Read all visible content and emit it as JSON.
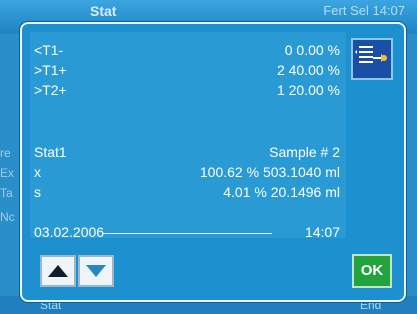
{
  "background": {
    "title": "Stat",
    "info": "Fert Sel 14:07",
    "left_fragments": [
      "re",
      "Ex",
      "Ta",
      "Nc"
    ],
    "bottom_left": "Stat",
    "bottom_right": "End"
  },
  "dialog": {
    "rows": [
      {
        "label": "<T1-",
        "value": "0   0.00 %"
      },
      {
        "label": ">T1+",
        "value": "2  40.00 %"
      },
      {
        "label": ">T2+",
        "value": "1  20.00 %"
      }
    ],
    "stat": {
      "label": "Stat1",
      "sample": "Sample # 2"
    },
    "x": {
      "label": "x",
      "value": "100.62 %  503.1040 ml"
    },
    "s": {
      "label": "s",
      "value": "4.01 %   20.1496 ml"
    },
    "date": "03.02.2006",
    "time": "14:07",
    "ok_label": "OK"
  },
  "colors": {
    "dialog_bg": "#1d91cf",
    "ok_green": "#23a33e",
    "icon_blue": "#1a4fa6"
  }
}
